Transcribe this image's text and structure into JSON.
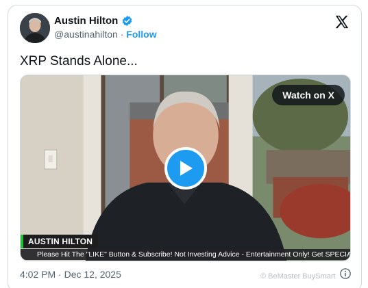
{
  "author": {
    "name": "Austin Hilton",
    "handle": "@austinahilton",
    "separator": "·",
    "follow_label": "Follow",
    "verified_icon": "verified-badge-icon"
  },
  "platform_icon": "x-logo-icon",
  "tweet": {
    "text": "XRP Stands Alone...",
    "timestamp": "4:02 PM · Dec 12, 2025"
  },
  "media": {
    "watch_label": "Watch on X",
    "play_icon": "play-icon",
    "lower_third_name": "AUSTIN HILTON",
    "ticker_text": "Please Hit The \"LIKE\" Button & Subscribe! Not Investing Advice - Entertainment Only! Get SPECIAL"
  },
  "info_icon": "info-icon",
  "watermark": "© BeMaster BuySmart",
  "colors": {
    "accent": "#1d9bf0",
    "text": "#0f1419",
    "muted": "#536471",
    "lower_third_bar": "#1fbf3a"
  }
}
